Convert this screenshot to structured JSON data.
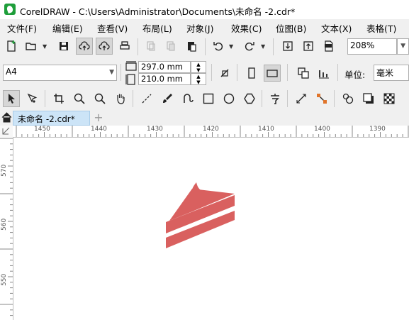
{
  "window": {
    "title": "CorelDRAW - C:\\Users\\Administrator\\Documents\\未命名 -2.cdr*"
  },
  "menu": [
    "文件(F)",
    "编辑(E)",
    "查看(V)",
    "布局(L)",
    "对象(J)",
    "效果(C)",
    "位图(B)",
    "文本(X)",
    "表格(T)"
  ],
  "toolbar": {
    "zoom_value": "208%"
  },
  "propbar": {
    "page_size": "A4",
    "width_value": "297.0 mm",
    "height_value": "210.0 mm",
    "units_label": "单位:",
    "units_value": "毫米"
  },
  "tabs": {
    "document_tab": "未命名 -2.cdr*",
    "add_tab": "+"
  },
  "rulers": {
    "horizontal": [
      "1450",
      "1440",
      "1430",
      "1420",
      "1410",
      "1400",
      "1390"
    ],
    "vertical": [
      "570",
      "560",
      "550"
    ]
  },
  "icons": {
    "toolbar1": [
      "new-document-icon",
      "open-folder-icon",
      "save-icon",
      "cloud-upload-icon",
      "cloud-sync-icon",
      "print-icon",
      "cut-icon",
      "copy-icon",
      "paste-icon",
      "undo-icon",
      "redo-icon",
      "import-icon",
      "export-icon",
      "pdf-icon"
    ],
    "toolbox": [
      "pick-tool-icon",
      "shape-tool-icon",
      "crop-tool-icon",
      "zoom-tool-icon",
      "zoom-out-icon",
      "pan-hand-icon",
      "freehand-tool-icon",
      "artistic-media-icon",
      "bezier-curve-icon",
      "rectangle-tool-icon",
      "ellipse-tool-icon",
      "polygon-tool-icon",
      "text-tool-icon",
      "dimension-tool-icon",
      "connector-tool-icon",
      "color-dropper-icon",
      "drop-shadow-icon",
      "transparency-icon"
    ]
  },
  "colors": {
    "accent_tab": "#cce4f7",
    "artwork": "#d9605f",
    "logo": "#1e9e3a"
  }
}
